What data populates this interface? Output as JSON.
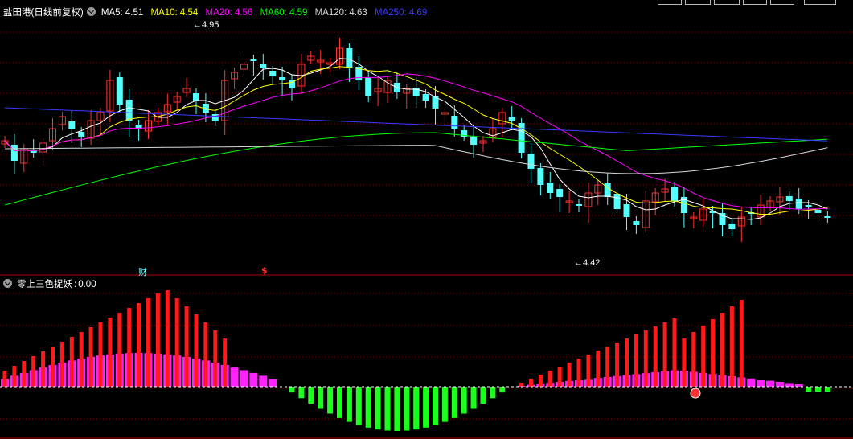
{
  "stock": {
    "name": "盐田港",
    "mode": "(日线前复权)"
  },
  "ma_legend": [
    {
      "label": "MA5: 4.51",
      "color": "#ffffff"
    },
    {
      "label": "MA10: 4.54",
      "color": "#ffff00"
    },
    {
      "label": "MA20: 4.56",
      "color": "#ff00ff"
    },
    {
      "label": "MA60: 4.59",
      "color": "#00ff00"
    },
    {
      "label": "MA120: 4.63",
      "color": "#d8d8d8"
    },
    {
      "label": "MA250: 4.69",
      "color": "#3a3aff"
    }
  ],
  "price_annotations": {
    "high": "4.95",
    "low": "4.42"
  },
  "event_markers": {
    "cai": "财",
    "dollar": "$"
  },
  "indicator": {
    "name": "零上三色捉妖",
    "value": "0.00"
  },
  "colors": {
    "up": "#ff3232",
    "down": "#54ffff",
    "indicator_red": "#ff1a1a",
    "indicator_magenta": "#ff22ff",
    "indicator_green": "#1cff1c",
    "grid": "#7a0000"
  }
}
